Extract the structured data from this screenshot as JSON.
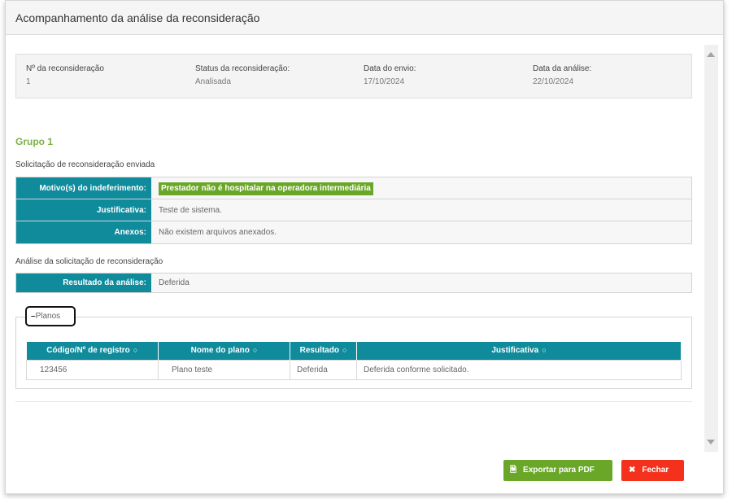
{
  "modal": {
    "title": "Acompanhamento da análise da reconsideração"
  },
  "summary": {
    "numero_label": "Nº da reconsideração",
    "numero_value": "1",
    "status_label": "Status da reconsideração:",
    "status_value": "Analisada",
    "envio_label": "Data do envio:",
    "envio_value": "17/10/2024",
    "analise_label": "Data da análise:",
    "analise_value": "22/10/2024"
  },
  "group": {
    "title": "Grupo 1"
  },
  "solicitacao": {
    "title": "Solicitação de reconsideração enviada",
    "rows": [
      {
        "key": "Motivo(s) do indeferimento:",
        "value": "Prestador não é hospitalar na operadora intermediária"
      },
      {
        "key": "Justificativa:",
        "value": "Teste de sistema."
      },
      {
        "key": "Anexos:",
        "value": "Não existem arquivos anexados."
      }
    ]
  },
  "analise": {
    "title": "Análise da solicitação de reconsideração",
    "result_key": "Resultado da análise:",
    "result_value": "Deferida"
  },
  "planos": {
    "legend": "Planos",
    "headers": [
      "Código/Nº de registro",
      "Nome do plano",
      "Resultado",
      "Justificativa"
    ],
    "rows": [
      {
        "codigo": "123456",
        "nome": "Plano teste",
        "resultado": "Deferida",
        "justificativa": "Deferida conforme solicitado."
      }
    ]
  },
  "actions": {
    "export_label": "Exportar para PDF",
    "close_label": "Fechar"
  },
  "colors": {
    "teal": "#0f8b9c",
    "green": "#6aa728",
    "red": "#f4311d",
    "group_green": "#7cb342"
  }
}
